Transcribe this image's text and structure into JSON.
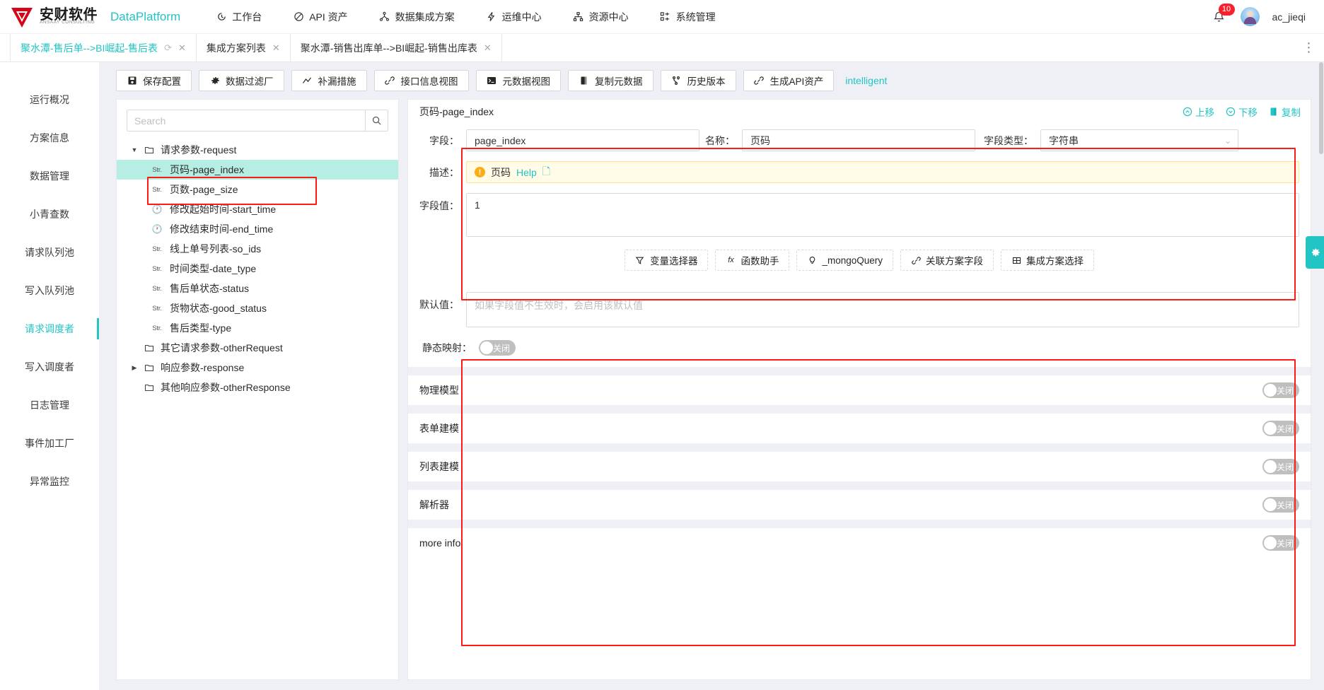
{
  "header": {
    "brand_cn": "安财软件",
    "brand_sub": "ANSAAY CONSULTING",
    "platform": "DataPlatform",
    "nav": [
      {
        "label": "工作台",
        "icon": "clock-icon"
      },
      {
        "label": "API 资产",
        "icon": "slash-circle-icon"
      },
      {
        "label": "数据集成方案",
        "icon": "sitemap-icon"
      },
      {
        "label": "运维中心",
        "icon": "bolt-icon"
      },
      {
        "label": "资源中心",
        "icon": "cluster-icon"
      },
      {
        "label": "系统管理",
        "icon": "settings-grid-icon"
      }
    ],
    "notification_count": "10",
    "username": "ac_jieqi"
  },
  "tabs": [
    {
      "label": "聚水潭-售后单-->BI崛起-售后表",
      "active": true,
      "refresh": true,
      "closable": true
    },
    {
      "label": "集成方案列表",
      "active": false,
      "refresh": false,
      "closable": true
    },
    {
      "label": "聚水潭-销售出库单-->BI崛起-销售出库表",
      "active": false,
      "refresh": false,
      "closable": true
    }
  ],
  "tabbar_more": "⋮",
  "rail": {
    "items": [
      {
        "label": "运行概况",
        "active": false
      },
      {
        "label": "方案信息",
        "active": false
      },
      {
        "label": "数据管理",
        "active": false
      },
      {
        "label": "小青查数",
        "active": false
      },
      {
        "label": "请求队列池",
        "active": false
      },
      {
        "label": "写入队列池",
        "active": false
      },
      {
        "label": "请求调度者",
        "active": true
      },
      {
        "label": "写入调度者",
        "active": false
      },
      {
        "label": "日志管理",
        "active": false
      },
      {
        "label": "事件加工厂",
        "active": false
      },
      {
        "label": "异常监控",
        "active": false
      }
    ]
  },
  "toolbar": {
    "buttons": [
      {
        "label": "保存配置",
        "icon": "save-icon"
      },
      {
        "label": "数据过滤厂",
        "icon": "gear-icon"
      },
      {
        "label": "补漏措施",
        "icon": "chart-line-icon"
      },
      {
        "label": "接口信息视图",
        "icon": "link-icon"
      },
      {
        "label": "元数据视图",
        "icon": "terminal-icon"
      },
      {
        "label": "复制元数据",
        "icon": "copy-icon"
      },
      {
        "label": "历史版本",
        "icon": "branch-icon"
      },
      {
        "label": "生成API资产",
        "icon": "link-icon"
      }
    ],
    "link": "intelligent"
  },
  "tree": {
    "search_placeholder": "Search",
    "search_value": "",
    "nodes": [
      {
        "label": "请求参数-request",
        "kind": "folder",
        "level": 1,
        "caret": "down",
        "selected": false
      },
      {
        "label": "页码-page_index",
        "kind": "str",
        "level": 2,
        "caret": "none",
        "selected": true
      },
      {
        "label": "页数-page_size",
        "kind": "str",
        "level": 2,
        "caret": "none",
        "selected": false
      },
      {
        "label": "修改起始时间-start_time",
        "kind": "clock",
        "level": 2,
        "caret": "none",
        "selected": false
      },
      {
        "label": "修改结束时间-end_time",
        "kind": "clock",
        "level": 2,
        "caret": "none",
        "selected": false
      },
      {
        "label": "线上单号列表-so_ids",
        "kind": "str",
        "level": 2,
        "caret": "none",
        "selected": false
      },
      {
        "label": "时间类型-date_type",
        "kind": "str",
        "level": 2,
        "caret": "none",
        "selected": false
      },
      {
        "label": "售后单状态-status",
        "kind": "str",
        "level": 2,
        "caret": "none",
        "selected": false
      },
      {
        "label": "货物状态-good_status",
        "kind": "str",
        "level": 2,
        "caret": "none",
        "selected": false
      },
      {
        "label": "售后类型-type",
        "kind": "str",
        "level": 2,
        "caret": "none",
        "selected": false
      },
      {
        "label": "其它请求参数-otherRequest",
        "kind": "folder",
        "level": 1,
        "caret": "none",
        "selected": false
      },
      {
        "label": "响应参数-response",
        "kind": "folder",
        "level": 1,
        "caret": "right",
        "selected": false
      },
      {
        "label": "其他响应参数-otherResponse",
        "kind": "folder",
        "level": 1,
        "caret": "none",
        "selected": false
      }
    ],
    "str_badge": "Str."
  },
  "detail": {
    "title": "页码-page_index",
    "actions": [
      {
        "label": "上移",
        "icon": "chevron-up-circle-icon"
      },
      {
        "label": "下移",
        "icon": "chevron-down-circle-icon"
      },
      {
        "label": "复制",
        "icon": "copy-icon"
      }
    ],
    "field_label": "字段：",
    "field_value": "page_index",
    "name_label": "名称：",
    "name_value": "页码",
    "type_label": "字段类型：",
    "type_value": "字符串",
    "desc_label": "描述：",
    "desc_text": "页码",
    "desc_help": "Help",
    "value_label": "字段值：",
    "value_text": "1",
    "helper_buttons": [
      {
        "label": "变量选择器",
        "icon": "filter-icon"
      },
      {
        "label": "函数助手",
        "icon": "fx-icon"
      },
      {
        "label": "_mongoQuery",
        "icon": "bulb-icon"
      },
      {
        "label": "关联方案字段",
        "icon": "link-icon"
      },
      {
        "label": "集成方案选择",
        "icon": "table-icon"
      }
    ],
    "default_label": "默认值：",
    "default_placeholder": "如果字段值不生效时，会启用该默认值",
    "default_value": "",
    "static_map_label": "静态映射：",
    "switch_off_text": "关闭",
    "sections": [
      {
        "label": "物理模型",
        "switch": "关闭"
      },
      {
        "label": "表单建模",
        "switch": "关闭"
      },
      {
        "label": "列表建模",
        "switch": "关闭"
      },
      {
        "label": "解析器",
        "switch": "关闭"
      },
      {
        "label": "more info",
        "switch": "关闭"
      }
    ]
  },
  "colors": {
    "accent": "#23c4c4",
    "badge": "#f5222d",
    "selection": "#b7eee4",
    "annotation": "#ff1a1a",
    "alert_bg": "#fffbe6",
    "alert_border": "#ffe58f"
  }
}
